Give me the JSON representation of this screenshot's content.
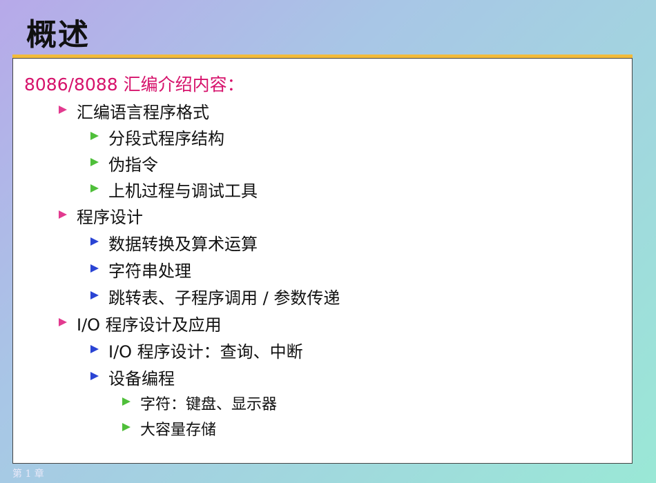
{
  "slide": {
    "title": "概述",
    "heading": "8086/8088 汇编介绍内容：",
    "footer": "第 1 章",
    "items": [
      {
        "text": "汇编语言程序格式"
      },
      {
        "text": "分段式程序结构"
      },
      {
        "text": "伪指令"
      },
      {
        "text": "上机过程与调试工具"
      },
      {
        "text": "程序设计"
      },
      {
        "text": "数据转换及算术运算"
      },
      {
        "text": "字符串处理"
      },
      {
        "text": "跳转表、子程序调用 / 参数传递"
      },
      {
        "text": "I/O 程序设计及应用"
      },
      {
        "text": "I/O 程序设计：查询、中断"
      },
      {
        "text": "设备编程"
      },
      {
        "text": "字符：键盘、显示器"
      },
      {
        "text": "大容量存储"
      }
    ]
  },
  "colors": {
    "heading": "#d6126b",
    "accent_bar": "#f2bb3a",
    "bullet_pink": "#e23a8f",
    "bullet_green": "#4fbf3a",
    "bullet_blue": "#2a44d4"
  }
}
